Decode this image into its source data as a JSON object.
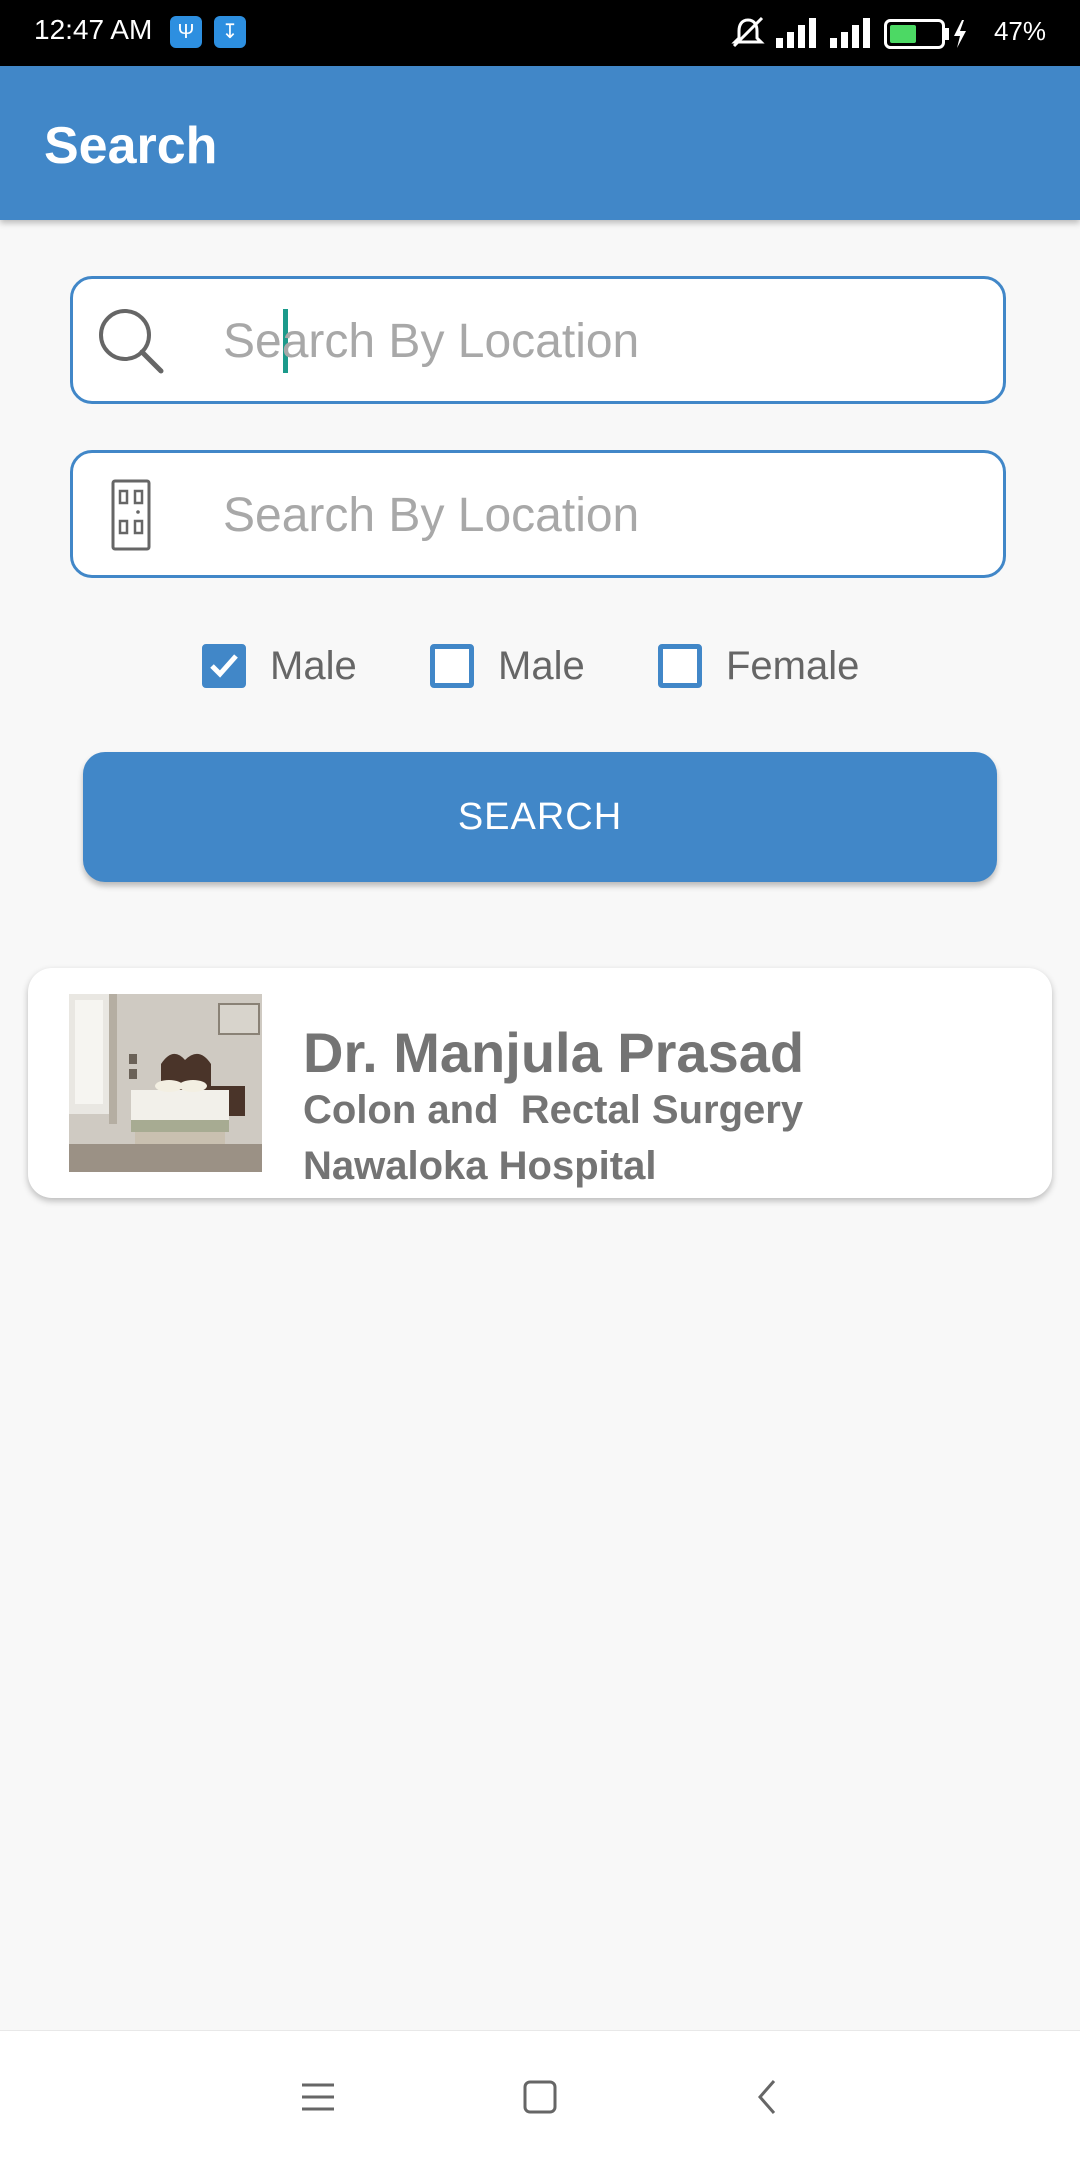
{
  "status_bar": {
    "time": "12:47 AM",
    "battery_percent": "47%",
    "icons": [
      "usb-icon",
      "download-icon",
      "muted-icon",
      "signal-icon",
      "signal-icon",
      "battery-icon",
      "charging-icon"
    ]
  },
  "app_bar": {
    "title": "Search"
  },
  "search": {
    "location_placeholder": "Search By Location",
    "location_value": "",
    "building_placeholder": "Search By Location",
    "building_value": "",
    "location_icon": "search-icon",
    "building_icon": "building-icon"
  },
  "filters": {
    "options": [
      {
        "label": "Male",
        "checked": true
      },
      {
        "label": "Male",
        "checked": false
      },
      {
        "label": "Female",
        "checked": false
      }
    ]
  },
  "search_button": {
    "label": "SEARCH"
  },
  "results": [
    {
      "name": "Dr. Manjula Prasad",
      "specialty": "Colon and  Rectal Surgery",
      "hospital": "Nawaloka Hospital",
      "image": "bedroom-photo"
    }
  ],
  "nav_bar": {
    "icons": [
      "menu-icon",
      "home-icon",
      "back-icon"
    ]
  },
  "colors": {
    "primary": "#4187c8",
    "accent": "#1b9a8b",
    "text_muted": "#747474"
  }
}
